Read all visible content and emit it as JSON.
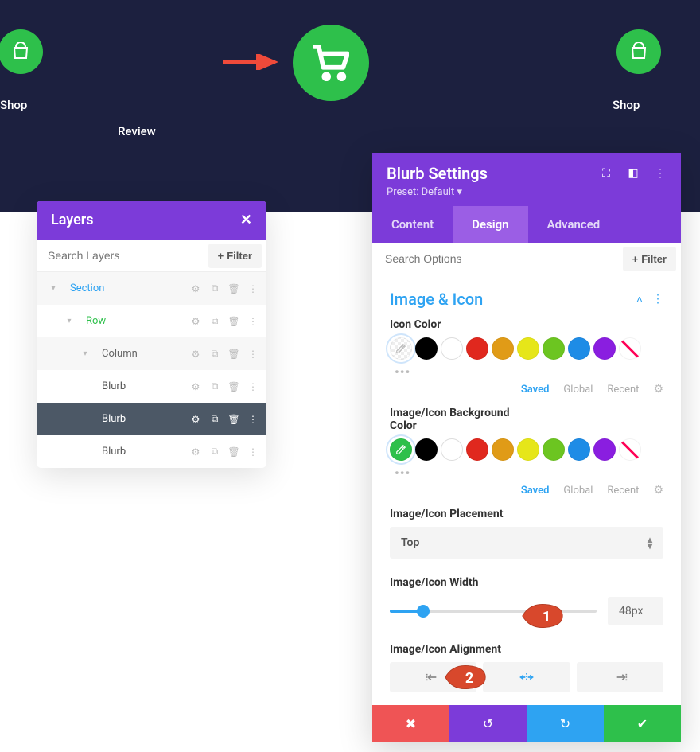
{
  "header": {
    "shop_label_left": "Shop",
    "shop_label_right": "Shop",
    "review_label": "Review"
  },
  "layers_panel": {
    "title": "Layers",
    "search_placeholder": "Search Layers",
    "filter_label": "Filter",
    "items": [
      {
        "label": "Section",
        "type": "section",
        "indent": 1
      },
      {
        "label": "Row",
        "type": "row",
        "indent": 2
      },
      {
        "label": "Column",
        "type": "column",
        "indent": 3
      },
      {
        "label": "Blurb",
        "type": "blurb",
        "indent": 4
      },
      {
        "label": "Blurb",
        "type": "blurb",
        "indent": 4,
        "active": true
      },
      {
        "label": "Blurb",
        "type": "blurb",
        "indent": 4
      }
    ]
  },
  "settings_panel": {
    "title": "Blurb Settings",
    "preset": "Preset: Default",
    "tabs": {
      "content": "Content",
      "design": "Design",
      "advanced": "Advanced"
    },
    "search_placeholder": "Search Options",
    "filter_label": "Filter",
    "section_title": "Image & Icon",
    "icon_color_label": "Icon Color",
    "bg_color_label": "Image/Icon Background Color",
    "swatch_meta": {
      "saved": "Saved",
      "global": "Global",
      "recent": "Recent"
    },
    "placement_label": "Image/Icon Placement",
    "placement_value": "Top",
    "width_label": "Image/Icon Width",
    "width_value": "48px",
    "alignment_label": "Image/Icon Alignment",
    "swatches": {
      "palette": [
        "#000000",
        "#ffffff",
        "#e0281e",
        "#e09b17",
        "#e6e619",
        "#6cc521",
        "#1e8ce6",
        "#8a1ee0"
      ]
    },
    "colors": {
      "icon_color_selected": "transparent",
      "bg_color_selected": "#2ec04b"
    }
  },
  "callouts": {
    "one": "1",
    "two": "2"
  }
}
